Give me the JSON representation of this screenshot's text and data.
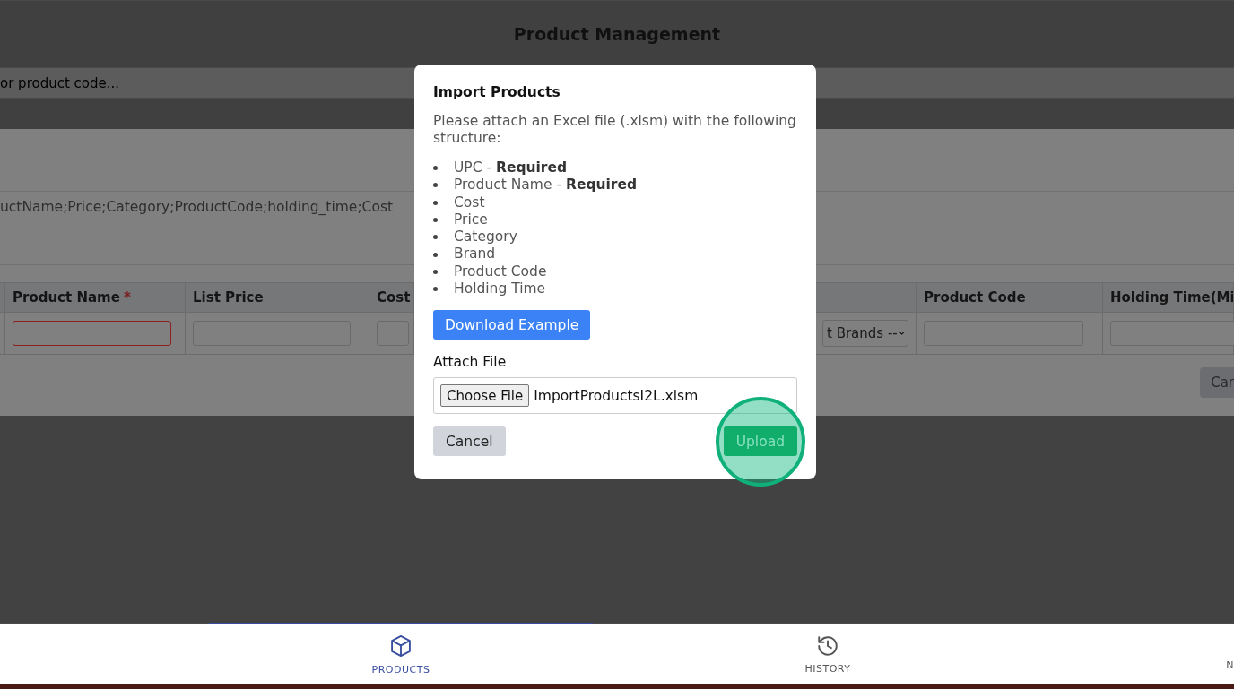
{
  "header": {
    "title": "Product Management"
  },
  "search": {
    "placeholder": "or product code..."
  },
  "format_hint": "uctName;Price;Category;ProductCode;holding_time;Cost",
  "table": {
    "columns": [
      {
        "label": "Product Name",
        "required_mark": "*"
      },
      {
        "label": "List Price"
      },
      {
        "label": "Cost"
      },
      {},
      {
        "label": "Product Code"
      },
      {
        "label": "Holding Time(Mi"
      }
    ],
    "row": [
      {
        "kind": "input",
        "invalid": true
      },
      {
        "kind": "input",
        "invalid": false
      },
      {
        "kind": "input",
        "invalid": false
      },
      {
        "kind": "select",
        "value": "t Brands --"
      },
      {
        "kind": "input",
        "invalid": false
      },
      {
        "kind": "input",
        "invalid": false
      }
    ],
    "cancel": "Car"
  },
  "dialog": {
    "title": "Import Products",
    "description": "Please attach an Excel file (.xlsm) with the following structure:",
    "fields": [
      "UPC - **Required**",
      "Product Name - **Required**",
      "Cost",
      "Price",
      "Category",
      "Brand",
      "Product Code",
      "Holding Time"
    ],
    "download_button": "Download Example",
    "attach_label": "Attach File",
    "choose_button": "Choose File",
    "file_name": "ImportProductsI2L.xlsm",
    "cancel_button": "Cancel",
    "upload_button": "Upload",
    "upload_highlighted": true
  },
  "bottom_nav": [
    {
      "label": "PRODUCTS",
      "selected": true
    },
    {
      "label": "HISTORY",
      "selected": false
    },
    {
      "label": "N",
      "selected": false
    }
  ]
}
